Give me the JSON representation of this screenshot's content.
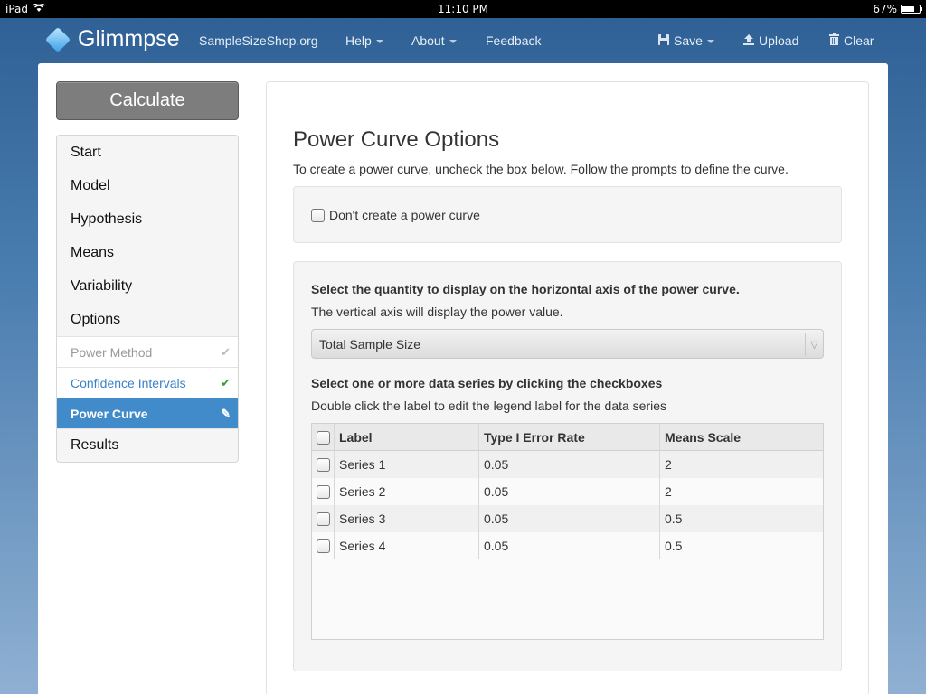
{
  "status_bar": {
    "device": "iPad",
    "time": "11:10 PM",
    "battery": "67%",
    "battery_level": 0.67
  },
  "navbar": {
    "brand": "Glimmpse",
    "links": {
      "site": "SampleSizeShop.org",
      "help": "Help",
      "about": "About",
      "feedback": "Feedback"
    },
    "actions": {
      "save": "Save",
      "upload": "Upload",
      "clear": "Clear"
    }
  },
  "sidebar": {
    "calculate": "Calculate",
    "items": {
      "start": "Start",
      "model": "Model",
      "hypothesis": "Hypothesis",
      "means": "Means",
      "variability": "Variability",
      "options": "Options",
      "power_method": "Power Method",
      "confidence_intervals": "Confidence Intervals",
      "power_curve": "Power Curve",
      "results": "Results"
    }
  },
  "main": {
    "title": "Power Curve Options",
    "subtitle": "To create a power curve, uncheck the box below. Follow the prompts to define the curve.",
    "no_curve_label": "Don't create a power curve",
    "axis_question": "Select the quantity to display on the horizontal axis of the power curve.",
    "axis_note": "The vertical axis will display the power value.",
    "axis_select": "Total Sample Size",
    "series_question": "Select one or more data series by clicking the checkboxes",
    "series_note": "Double click the label to edit the legend label for the data series",
    "table": {
      "headers": {
        "label": "Label",
        "type1": "Type I Error Rate",
        "means": "Means Scale"
      },
      "rows": [
        {
          "label": "Series 1",
          "type1": "0.05",
          "means": "2"
        },
        {
          "label": "Series 2",
          "type1": "0.05",
          "means": "2"
        },
        {
          "label": "Series 3",
          "type1": "0.05",
          "means": "0.5"
        },
        {
          "label": "Series 4",
          "type1": "0.05",
          "means": "0.5"
        }
      ]
    }
  }
}
